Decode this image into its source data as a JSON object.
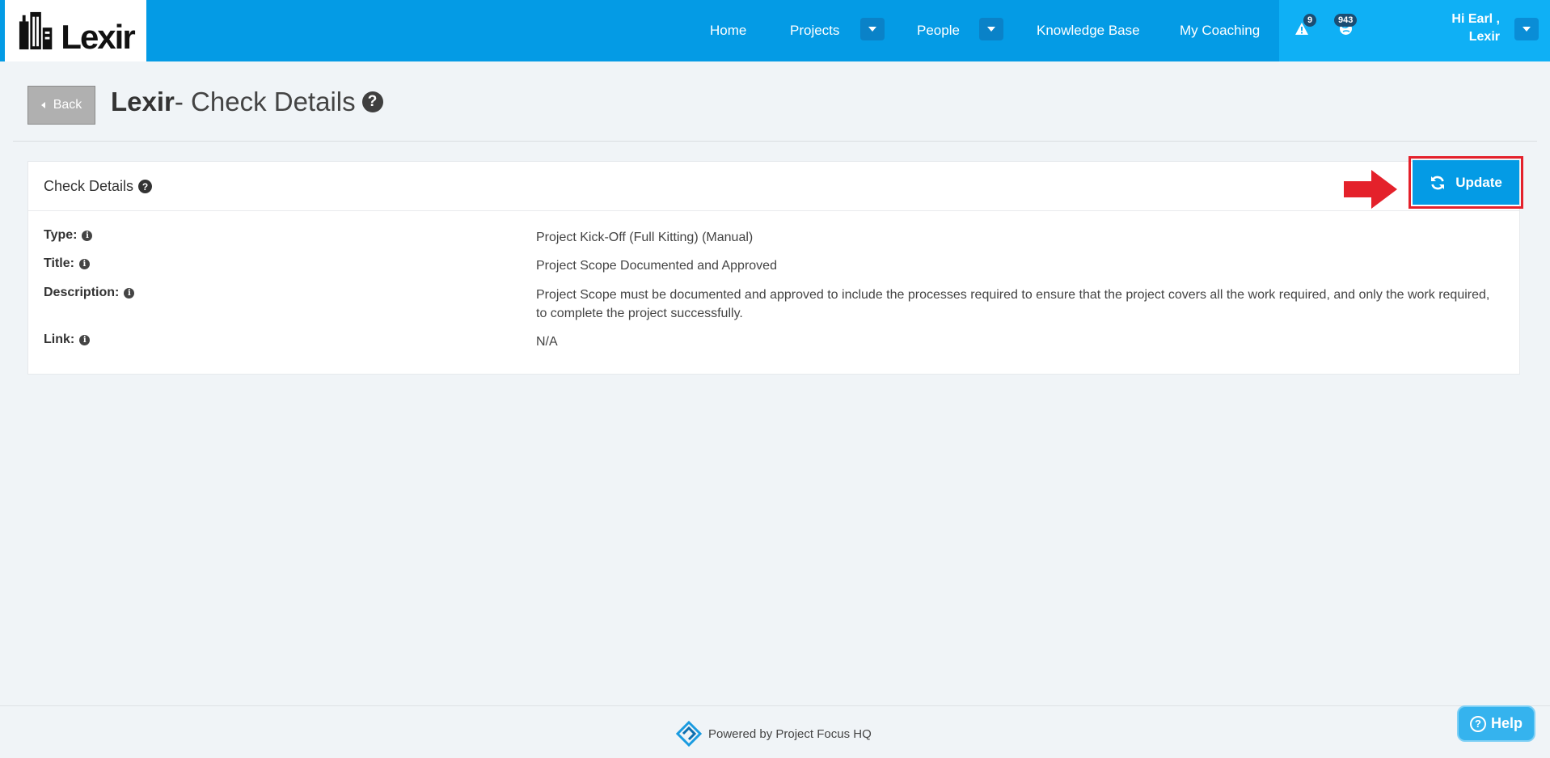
{
  "brand": {
    "logo_text": "Lexir"
  },
  "nav": {
    "home": "Home",
    "projects": "Projects",
    "people": "People",
    "knowledge_base": "Knowledge Base",
    "my_coaching": "My Coaching"
  },
  "notifications": {
    "alerts_count": "9",
    "messages_count": "943"
  },
  "user": {
    "greeting": "Hi Earl ,",
    "org": "Lexir"
  },
  "page": {
    "back_label": "Back",
    "title_brand": "Lexir",
    "title_rest": "- Check Details"
  },
  "card": {
    "title": "Check Details",
    "update_label": "Update",
    "rows": [
      {
        "label": "Type:",
        "value": "Project Kick-Off (Full Kitting) (Manual)"
      },
      {
        "label": "Title:",
        "value": "Project Scope Documented and Approved"
      },
      {
        "label": "Description:",
        "value": "Project Scope must be documented and approved to include the processes required to ensure that the project covers all the work required, and only the work required, to complete the project successfully."
      },
      {
        "label": "Link:",
        "value": "N/A"
      }
    ]
  },
  "footer": {
    "powered_by": "Powered by Project Focus HQ"
  },
  "help": {
    "label": "Help"
  },
  "colors": {
    "primary": "#049be5",
    "highlight": "#e4212b"
  }
}
